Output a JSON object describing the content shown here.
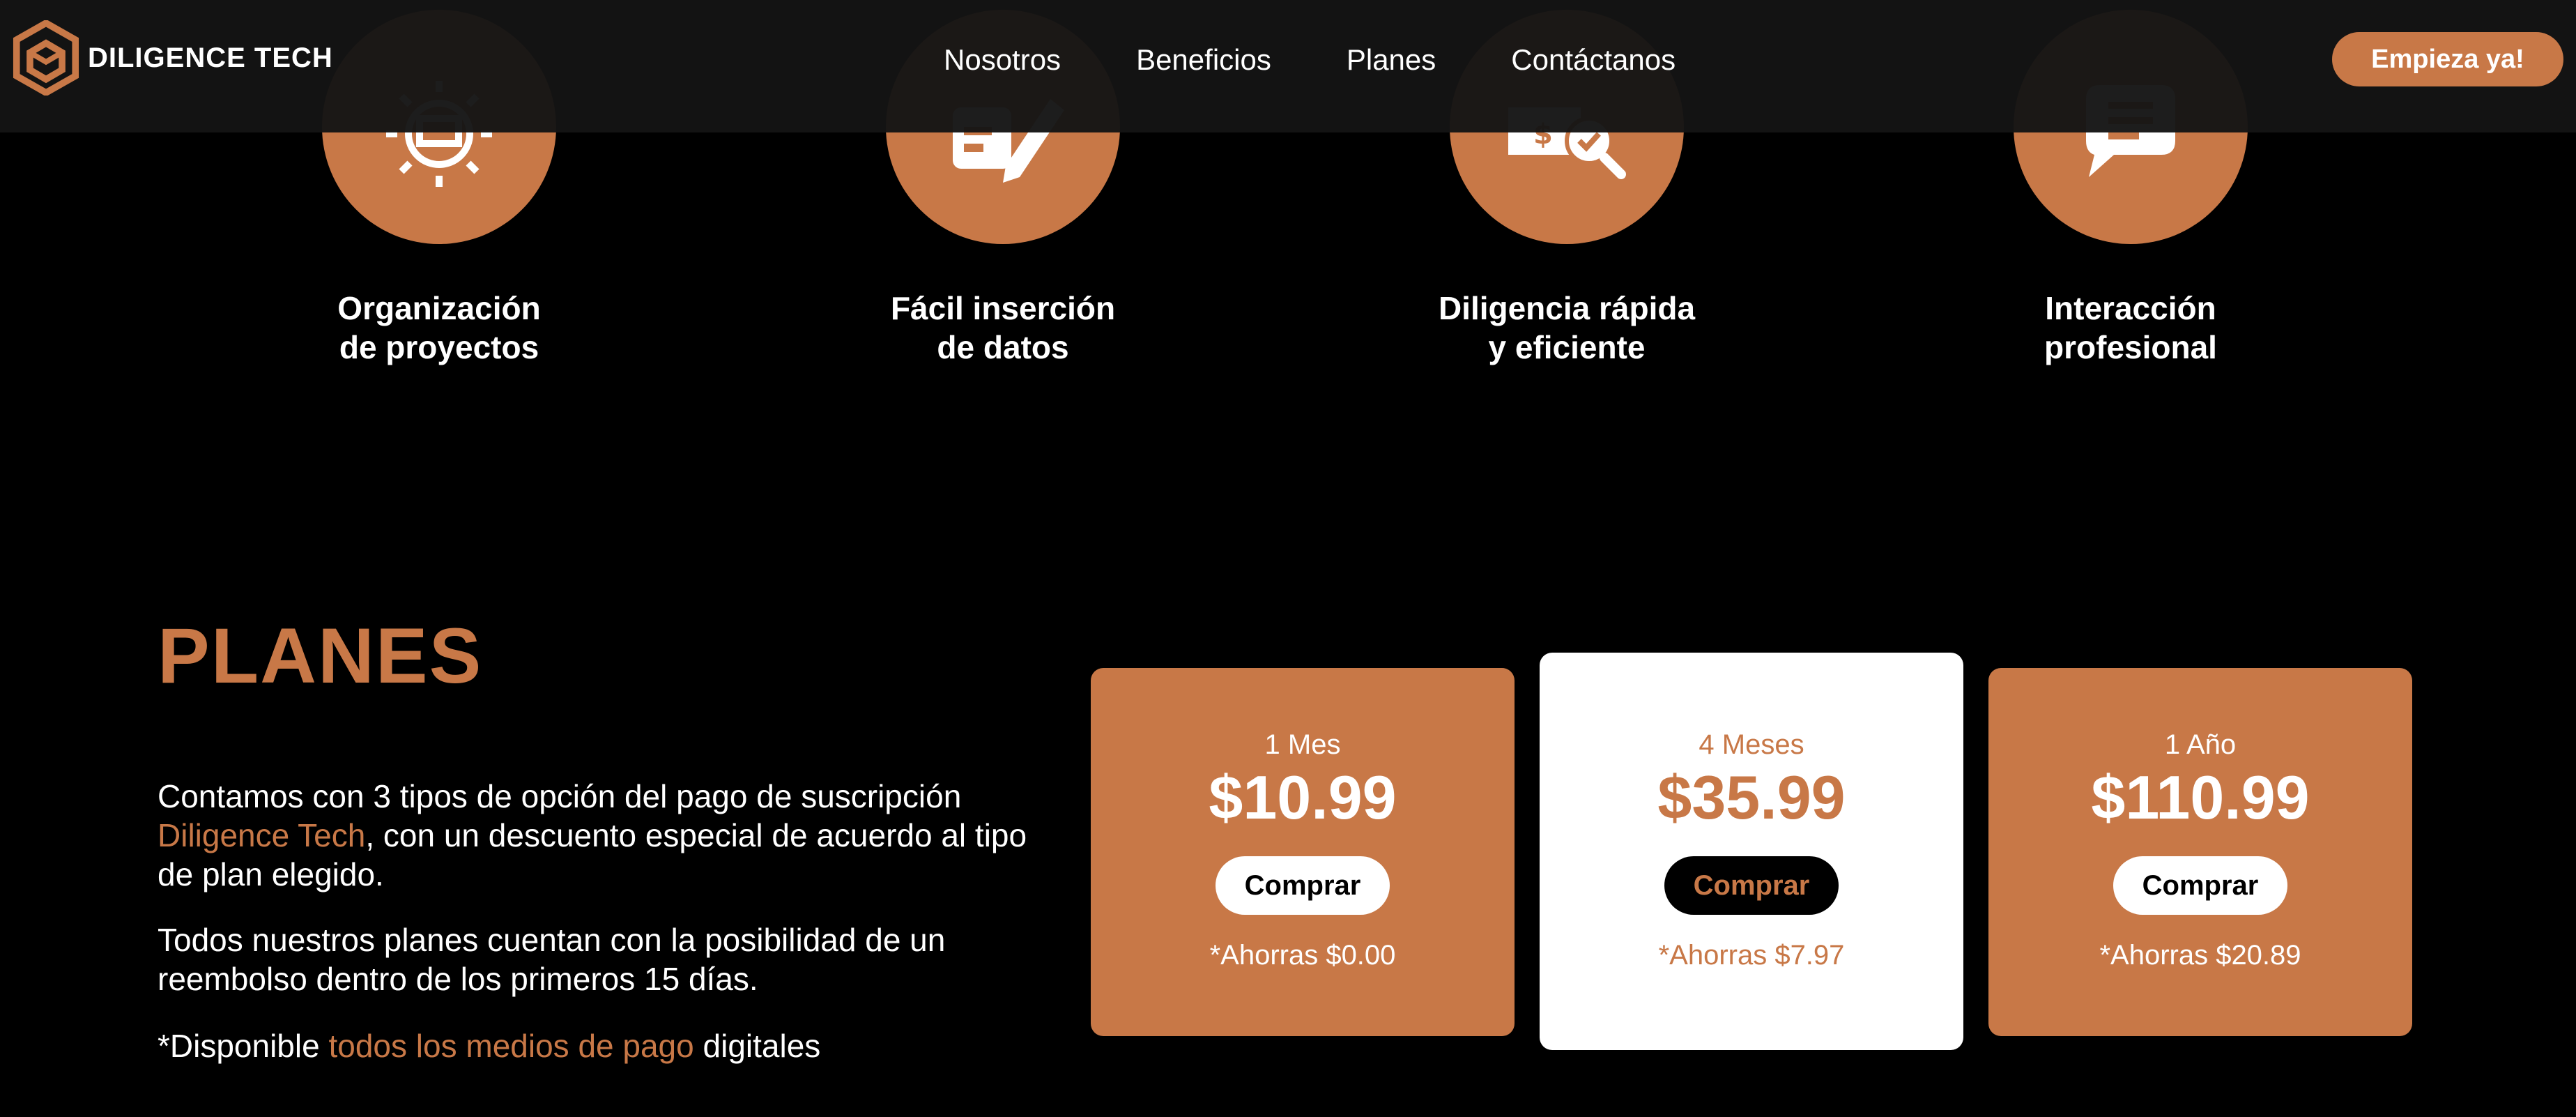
{
  "colors": {
    "accent": "#c87847",
    "background": "#000000",
    "header_bg": "#141414",
    "text": "#ffffff"
  },
  "header": {
    "brand": "DILIGENCE TECH",
    "logo_icon": "hexagon-cube-logo",
    "nav": [
      "Nosotros",
      "Beneficios",
      "Planes",
      "Contáctanos"
    ],
    "cta_label": "Empieza ya!"
  },
  "features": [
    {
      "icon": "gear-project-icon",
      "line1": "Organización",
      "line2": "de proyectos"
    },
    {
      "icon": "edit-document-icon",
      "line1": "Fácil inserción",
      "line2": "de datos"
    },
    {
      "icon": "money-search-icon",
      "line1": "Diligencia rápida",
      "line2": "y eficiente"
    },
    {
      "icon": "chat-bubble-icon",
      "line1": "Interacción",
      "line2": "profesional"
    }
  ],
  "planes": {
    "title": "PLANES",
    "p1_a": "Contamos con 3 tipos de opción del pago de suscripción ",
    "p1_link": "Diligence Tech",
    "p1_b": ", con un descuento especial de acuerdo al tipo de plan elegido.",
    "p2": "Todos nuestros planes cuentan con la posibilidad de un reembolso dentro de los primeros 15 días.",
    "p3_a": "*Disponible ",
    "p3_link": "todos los medios de pago",
    "p3_b": " digitales",
    "cards": [
      {
        "period": "1 Mes",
        "price": "$10.99",
        "button": "Comprar",
        "savings": "*Ahorras $0.00"
      },
      {
        "period": "4 Meses",
        "price": "$35.99",
        "button": "Comprar",
        "savings": "*Ahorras $7.97"
      },
      {
        "period": "1 Año",
        "price": "$110.99",
        "button": "Comprar",
        "savings": "*Ahorras $20.89"
      }
    ]
  }
}
